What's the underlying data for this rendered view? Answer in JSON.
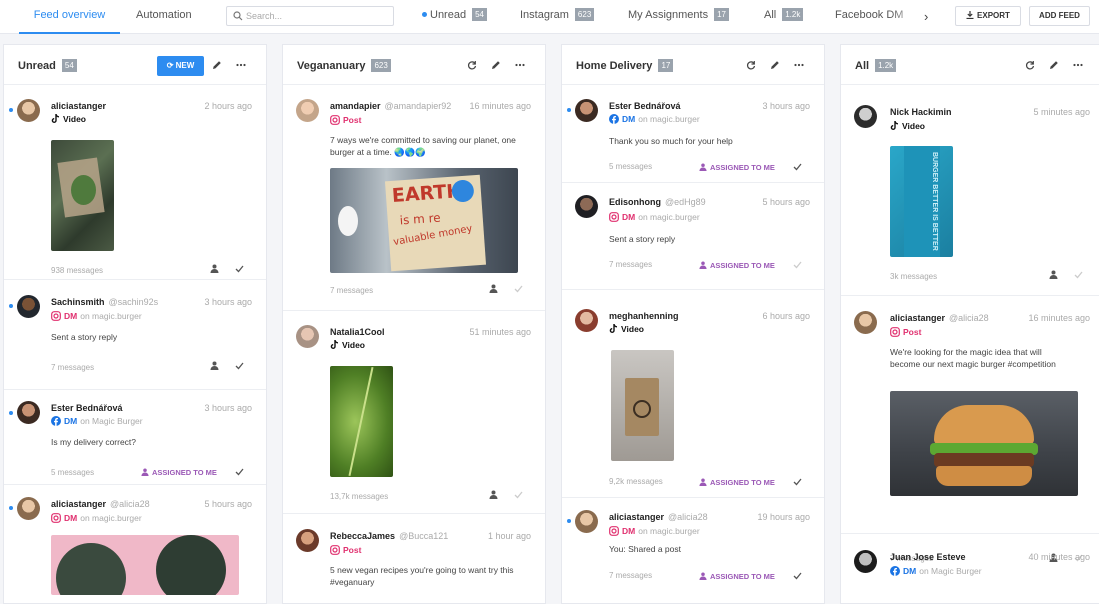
{
  "topbar": {
    "tab_feed": "Feed overview",
    "tab_automation": "Automation",
    "search_placeholder": "Search...",
    "filters": [
      {
        "label": "Unread",
        "count": "54"
      },
      {
        "label": "Instagram",
        "count": "623"
      },
      {
        "label": "My Assignments",
        "count": "17"
      },
      {
        "label": "All",
        "count": "1.2k"
      },
      {
        "label": "Facebook DM",
        "count": ""
      }
    ],
    "export_label": "EXPORT",
    "add_feed_label": "ADD FEED"
  },
  "columns": [
    {
      "title": "Unread",
      "count": "54",
      "new_label": "NEW",
      "cards": [
        {
          "user": "aliciastanger",
          "handle": "",
          "time": "2 hours ago",
          "kind": "Video",
          "on": "",
          "text": "",
          "messages": "938 messages",
          "assigned": ""
        },
        {
          "user": "Sachinsmith",
          "handle": "@sachin92s",
          "time": "3 hours ago",
          "kind": "DM",
          "on": "on magic.burger",
          "text": "Sent a story reply",
          "messages": "7 messages",
          "assigned": ""
        },
        {
          "user": "Ester Bednářová",
          "handle": "",
          "time": "3 hours ago",
          "kind": "DM",
          "on": "on Magic Burger",
          "text": "Is my delivery correct?",
          "messages": "5 messages",
          "assigned": "ASSIGNED TO ME"
        },
        {
          "user": "aliciastanger",
          "handle": "@alicia28",
          "time": "5 hours ago",
          "kind": "DM",
          "on": "on magic.burger",
          "text": "",
          "messages": "",
          "assigned": ""
        }
      ]
    },
    {
      "title": "Vegananuary",
      "count": "623",
      "cards": [
        {
          "user": "amandapier",
          "handle": "@amandapier92",
          "time": "16 minutes ago",
          "kind": "Post",
          "on": "",
          "text": "7 ways we're committed to saving our planet, one burger at a time. 🌏🌎🌍",
          "messages": "7 messages",
          "assigned": "",
          "sign_l1": "EARTH",
          "sign_l2": "is m re",
          "sign_l3": "valuable money"
        },
        {
          "user": "Natalia1Cool",
          "handle": "",
          "time": "51 minutes ago",
          "kind": "Video",
          "on": "",
          "text": "",
          "messages": "13,7k messages",
          "assigned": ""
        },
        {
          "user": "RebeccaJames",
          "handle": "@Bucca121",
          "time": "1 hour ago",
          "kind": "Post",
          "on": "",
          "text": "5 new vegan recipes you're going to want try this #veganuary",
          "messages": "",
          "assigned": ""
        }
      ]
    },
    {
      "title": "Home Delivery",
      "count": "17",
      "cards": [
        {
          "user": "Ester Bednářová",
          "handle": "",
          "time": "3 hours ago",
          "kind": "DM",
          "on": "on magic.burger",
          "text": "Thank you so much for your help",
          "messages": "5 messages",
          "assigned": "ASSIGNED TO ME"
        },
        {
          "user": "Edisonhong",
          "handle": "@edHg89",
          "time": "5 hours ago",
          "kind": "DM",
          "on": "on magic.burger",
          "text": "Sent a story reply",
          "messages": "7 messages",
          "assigned": "ASSIGNED TO ME"
        },
        {
          "user": "meghanhenning",
          "handle": "",
          "time": "6 hours ago",
          "kind": "Video",
          "on": "",
          "text": "",
          "messages": "9,2k messages",
          "assigned": "ASSIGNED TO ME"
        },
        {
          "user": "aliciastanger",
          "handle": "@alicia28",
          "time": "19 hours ago",
          "kind": "DM",
          "on": "on magic.burger",
          "text": "You: Shared a post",
          "messages": "7 messages",
          "assigned": "ASSIGNED TO ME"
        }
      ]
    },
    {
      "title": "All",
      "count": "1.2k",
      "cards": [
        {
          "user": "Nick Hackimin",
          "handle": "",
          "time": "5 minutes ago",
          "kind": "Video",
          "on": "",
          "text": "",
          "messages": "3k messages",
          "assigned": "",
          "box_text": "BURGER BETTER IS BETTER"
        },
        {
          "user": "aliciastanger",
          "handle": "@alicia28",
          "time": "16 minutes ago",
          "kind": "Post",
          "on": "",
          "text": "We're looking for the magic idea that will become our next magic burger #competition",
          "messages": "7 messages",
          "assigned": ""
        },
        {
          "user": "Juan Jose Esteve",
          "handle": "",
          "time": "40 minutes ago",
          "kind": "DM",
          "on": "on Magic Burger",
          "text": "",
          "messages": "",
          "assigned": ""
        }
      ]
    }
  ]
}
